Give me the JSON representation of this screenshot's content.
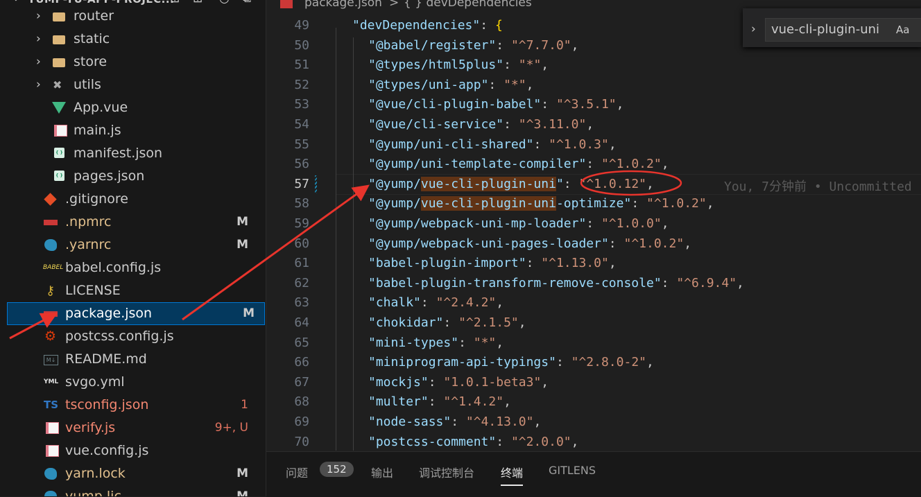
{
  "sidebar": {
    "project_title": "YUMP-YU-APP-PROJEC...",
    "actions": [
      "new-file-icon",
      "new-folder-icon",
      "refresh-icon",
      "collapse-icon"
    ],
    "items": [
      {
        "label": "router",
        "kind": "folder",
        "badge": ""
      },
      {
        "label": "static",
        "kind": "folder",
        "badge": ""
      },
      {
        "label": "store",
        "kind": "folder",
        "badge": ""
      },
      {
        "label": "utils",
        "kind": "folder",
        "badge": ""
      },
      {
        "label": "App.vue",
        "kind": "vue",
        "badge": ""
      },
      {
        "label": "main.js",
        "kind": "js",
        "badge": ""
      },
      {
        "label": "manifest.json",
        "kind": "json",
        "badge": ""
      },
      {
        "label": "pages.json",
        "kind": "json",
        "badge": ""
      },
      {
        "label": ".gitignore",
        "kind": "git",
        "badge": ""
      },
      {
        "label": ".npmrc",
        "kind": "npm",
        "badge": "M"
      },
      {
        "label": ".yarnrc",
        "kind": "yarn",
        "badge": "M"
      },
      {
        "label": "babel.config.js",
        "kind": "babel",
        "badge": ""
      },
      {
        "label": "LICENSE",
        "kind": "license",
        "badge": ""
      },
      {
        "label": "package.json",
        "kind": "npm",
        "badge": "M"
      },
      {
        "label": "postcss.config.js",
        "kind": "postcss",
        "badge": ""
      },
      {
        "label": "README.md",
        "kind": "md",
        "badge": ""
      },
      {
        "label": "svgo.yml",
        "kind": "yml",
        "badge": ""
      },
      {
        "label": "tsconfig.json",
        "kind": "ts",
        "badge": "1"
      },
      {
        "label": "verify.js",
        "kind": "js",
        "badge": "9+, U"
      },
      {
        "label": "vue.config.js",
        "kind": "js",
        "badge": ""
      },
      {
        "label": "yarn.lock",
        "kind": "yarn",
        "badge": "M"
      },
      {
        "label": "yump.lic",
        "kind": "yarn",
        "badge": "M"
      }
    ]
  },
  "editor": {
    "breadcrumb": {
      "file": "package.json",
      "sep": ">",
      "symbol": "{ } devDependencies"
    },
    "find_widget": {
      "value": "vue-cli-plugin-uni",
      "case_toggle": "Aa"
    },
    "blame": "You, 7分钟前 • Uncommitted",
    "lines": [
      {
        "n": "49",
        "key": "devDependencies",
        "val": "",
        "open": true
      },
      {
        "n": "50",
        "key": "@babel/register",
        "val": "^7.7.0"
      },
      {
        "n": "51",
        "key": "@types/html5plus",
        "val": "*"
      },
      {
        "n": "52",
        "key": "@types/uni-app",
        "val": "*"
      },
      {
        "n": "53",
        "key": "@vue/cli-plugin-babel",
        "val": "^3.5.1"
      },
      {
        "n": "54",
        "key": "@vue/cli-service",
        "val": "^3.11.0"
      },
      {
        "n": "55",
        "key": "@yump/uni-cli-shared",
        "val": "^1.0.3"
      },
      {
        "n": "56",
        "key": "@yump/uni-template-compiler",
        "val": "^1.0.2"
      },
      {
        "n": "57",
        "key": "@yump/vue-cli-plugin-uni",
        "val": "^1.0.12"
      },
      {
        "n": "58",
        "key": "@yump/vue-cli-plugin-uni-optimize",
        "val": "^1.0.2"
      },
      {
        "n": "59",
        "key": "@yump/webpack-uni-mp-loader",
        "val": "^1.0.0"
      },
      {
        "n": "60",
        "key": "@yump/webpack-uni-pages-loader",
        "val": "^1.0.2"
      },
      {
        "n": "61",
        "key": "babel-plugin-import",
        "val": "^1.13.0"
      },
      {
        "n": "62",
        "key": "babel-plugin-transform-remove-console",
        "val": "^6.9.4"
      },
      {
        "n": "63",
        "key": "chalk",
        "val": "^2.4.2"
      },
      {
        "n": "64",
        "key": "chokidar",
        "val": "^2.1.5"
      },
      {
        "n": "65",
        "key": "mini-types",
        "val": "*"
      },
      {
        "n": "66",
        "key": "miniprogram-api-typings",
        "val": "^2.8.0-2"
      },
      {
        "n": "67",
        "key": "mockjs",
        "val": "1.0.1-beta3"
      },
      {
        "n": "68",
        "key": "multer",
        "val": "^1.4.2"
      },
      {
        "n": "69",
        "key": "node-sass",
        "val": "^4.13.0"
      },
      {
        "n": "70",
        "key": "postcss-comment",
        "val": "^2.0.0"
      }
    ]
  },
  "panel": {
    "tabs": [
      "问题",
      "输出",
      "调试控制台",
      "终端",
      "GITLENS"
    ],
    "problems_count": "152",
    "active_tab": "终端"
  },
  "colors": {
    "accent": "#0078d4",
    "annotation_red": "#e8342c",
    "string": "#ce9178",
    "key": "#9cdcfe",
    "find_highlight": "#613315"
  }
}
